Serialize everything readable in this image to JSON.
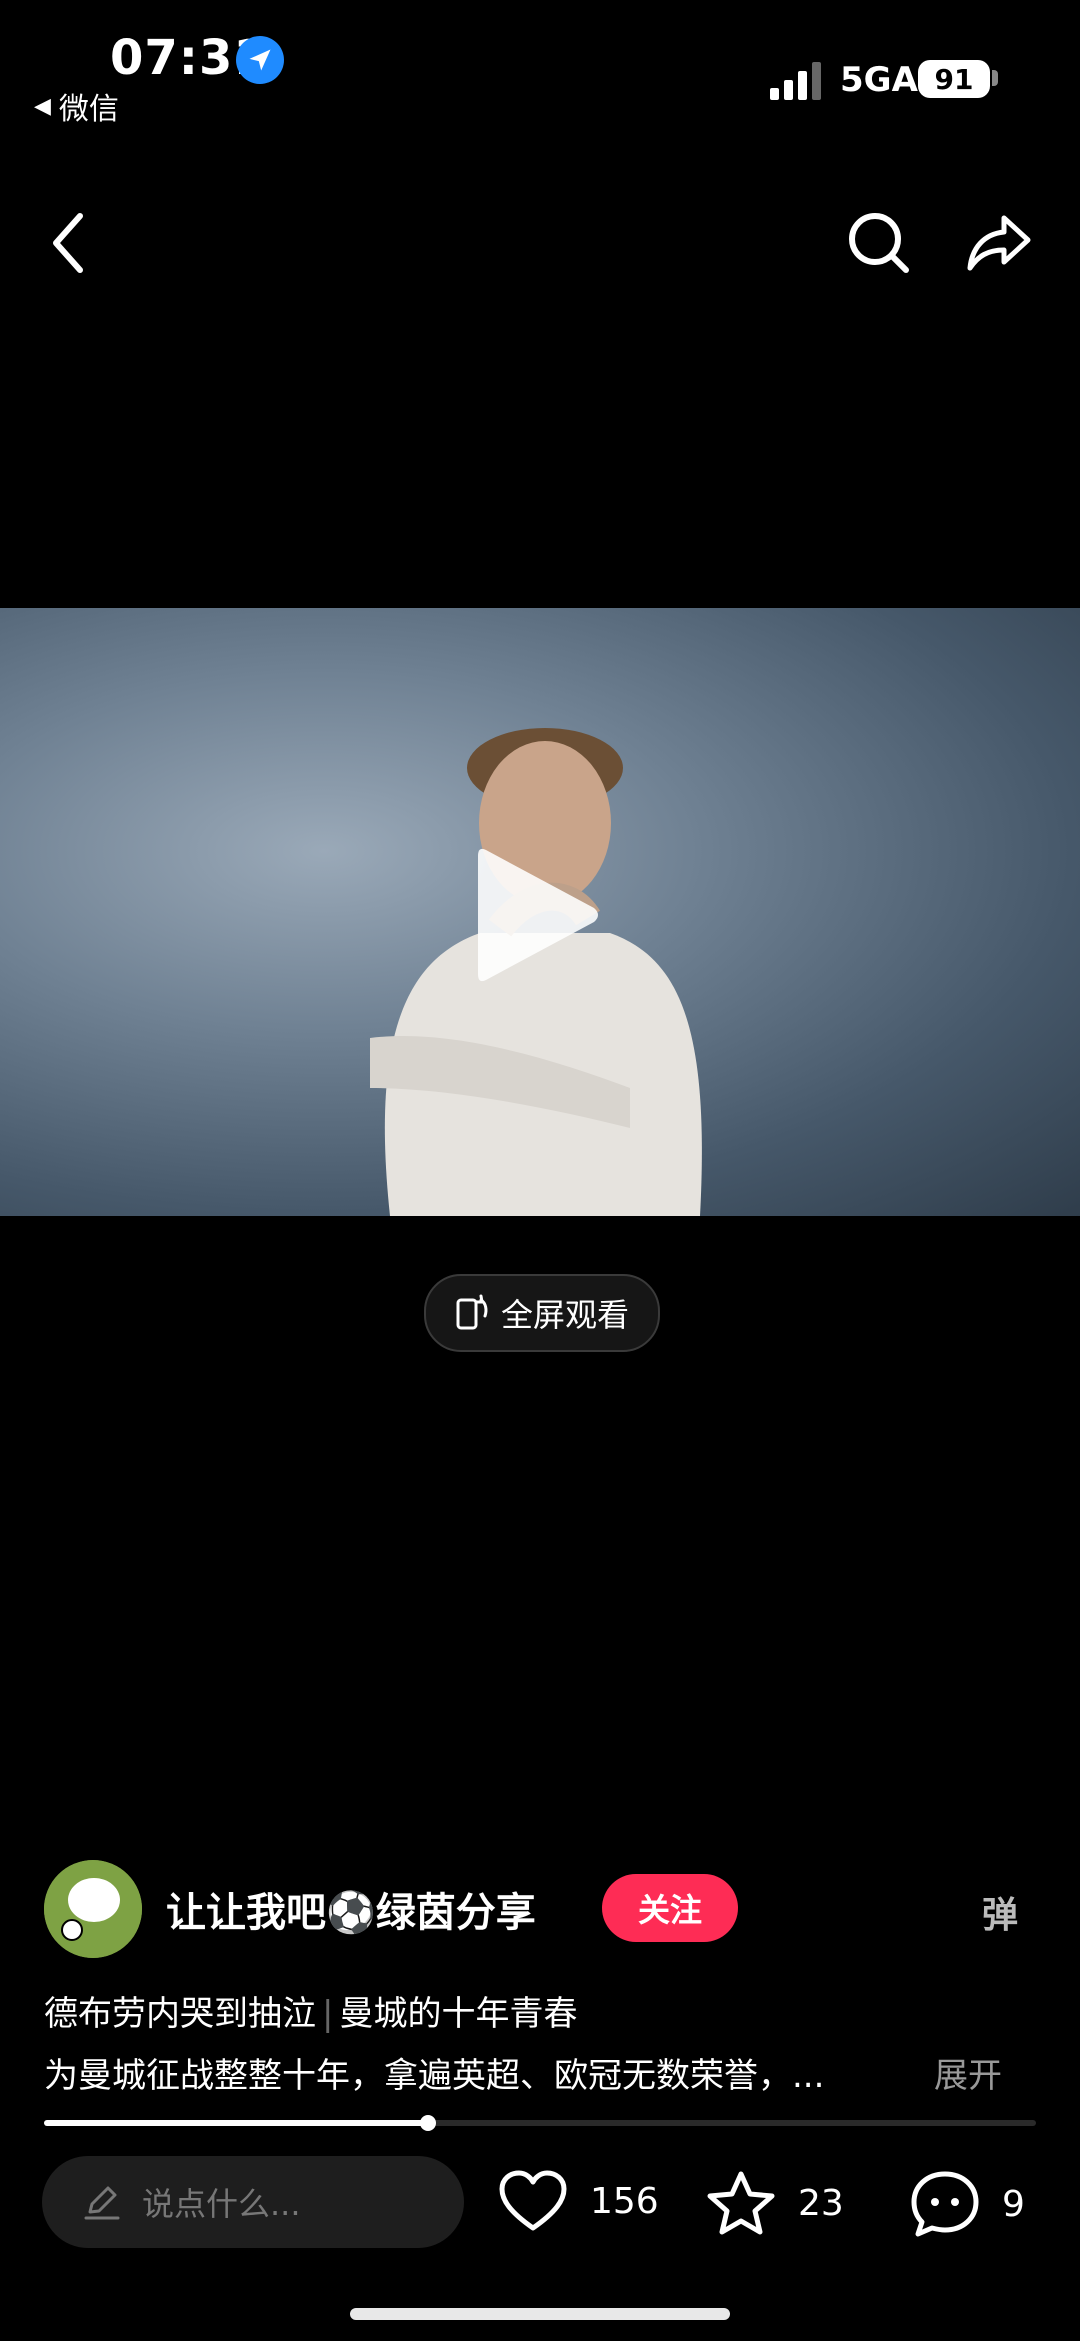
{
  "status_bar": {
    "time": "07:31",
    "back_app": "微信",
    "network": "5GA",
    "battery": "91"
  },
  "video": {
    "fullscreen_label": "全屏观看"
  },
  "author": {
    "name": "让让我吧⚽️绿茵分享",
    "follow_label": "关注",
    "danmaku_label": "弹"
  },
  "description": {
    "title_part1": "德布劳内哭到抽泣",
    "title_part2": "曼城的十年青春",
    "body": "为曼城征战整整十年，拿遍英超、欧冠无数荣誉，...",
    "expand_label": "展开"
  },
  "progress": {
    "fraction": 0.387
  },
  "bottom_bar": {
    "comment_placeholder": "说点什么...",
    "likes": "156",
    "favorites": "23",
    "comments": "9"
  },
  "colors": {
    "follow_bg": "#fe2c55",
    "location_badge": "#1f8bff"
  },
  "icons": [
    "location-arrow-icon",
    "signal-icon",
    "back-arrow-icon",
    "search-icon",
    "share-icon",
    "play-icon",
    "rotate-fullscreen-icon",
    "pencil-icon",
    "heart-icon",
    "star-icon",
    "comment-bubble-icon"
  ]
}
